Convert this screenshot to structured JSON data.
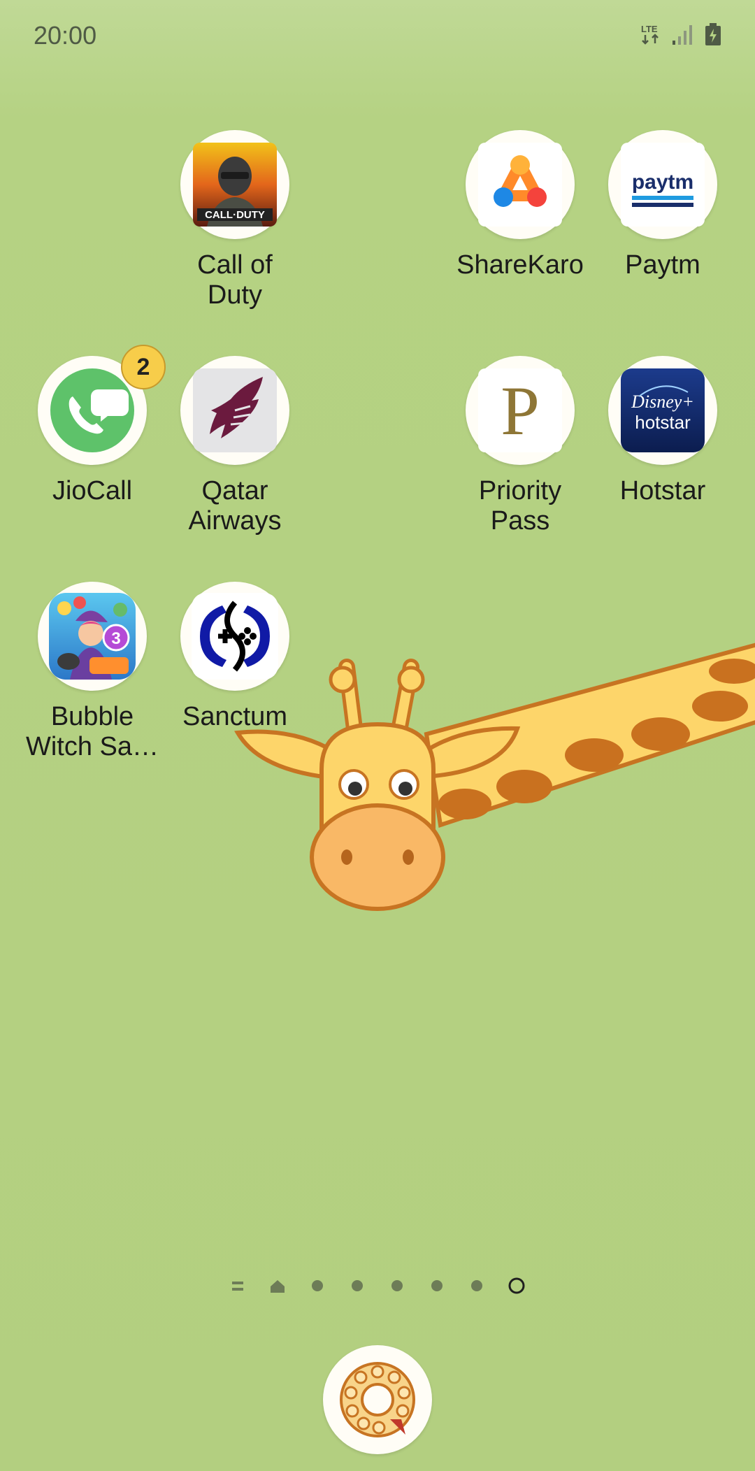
{
  "status_bar": {
    "time": "20:00",
    "network": "LTE"
  },
  "apps": [
    {
      "id": "call-of-duty",
      "label": "Call of\nDuty",
      "icon": "call-of-duty-icon",
      "icon_text": "CALL·DUTY"
    },
    {
      "id": "sharekaro",
      "label": "ShareKaro",
      "icon": "sharekaro-icon"
    },
    {
      "id": "paytm",
      "label": "Paytm",
      "icon": "paytm-icon",
      "icon_text": "paytm"
    },
    {
      "id": "jiocall",
      "label": "JioCall",
      "icon": "jiocall-icon",
      "badge": "2"
    },
    {
      "id": "qatar-airways",
      "label": "Qatar\nAirways",
      "icon": "qatar-airways-icon"
    },
    {
      "id": "priority-pass",
      "label": "Priority\nPass",
      "icon": "priority-pass-icon",
      "icon_text": "P"
    },
    {
      "id": "hotstar",
      "label": "Hotstar",
      "icon": "hotstar-icon",
      "icon_text_top": "Disney+",
      "icon_text_bottom": "hotstar"
    },
    {
      "id": "bubble-witch",
      "label": "Bubble\nWitch Sa…",
      "icon": "bubble-witch-icon",
      "icon_text": "3"
    },
    {
      "id": "sanctum",
      "label": "Sanctum",
      "icon": "sanctum-icon"
    }
  ],
  "page_indicator": {
    "total": 8,
    "current": 7
  },
  "dock": {
    "icon": "phone-dialer-icon"
  },
  "colors": {
    "background": "#b3cf80",
    "icon_bg": "#fffdf6",
    "badge": "#f7cd4a"
  }
}
